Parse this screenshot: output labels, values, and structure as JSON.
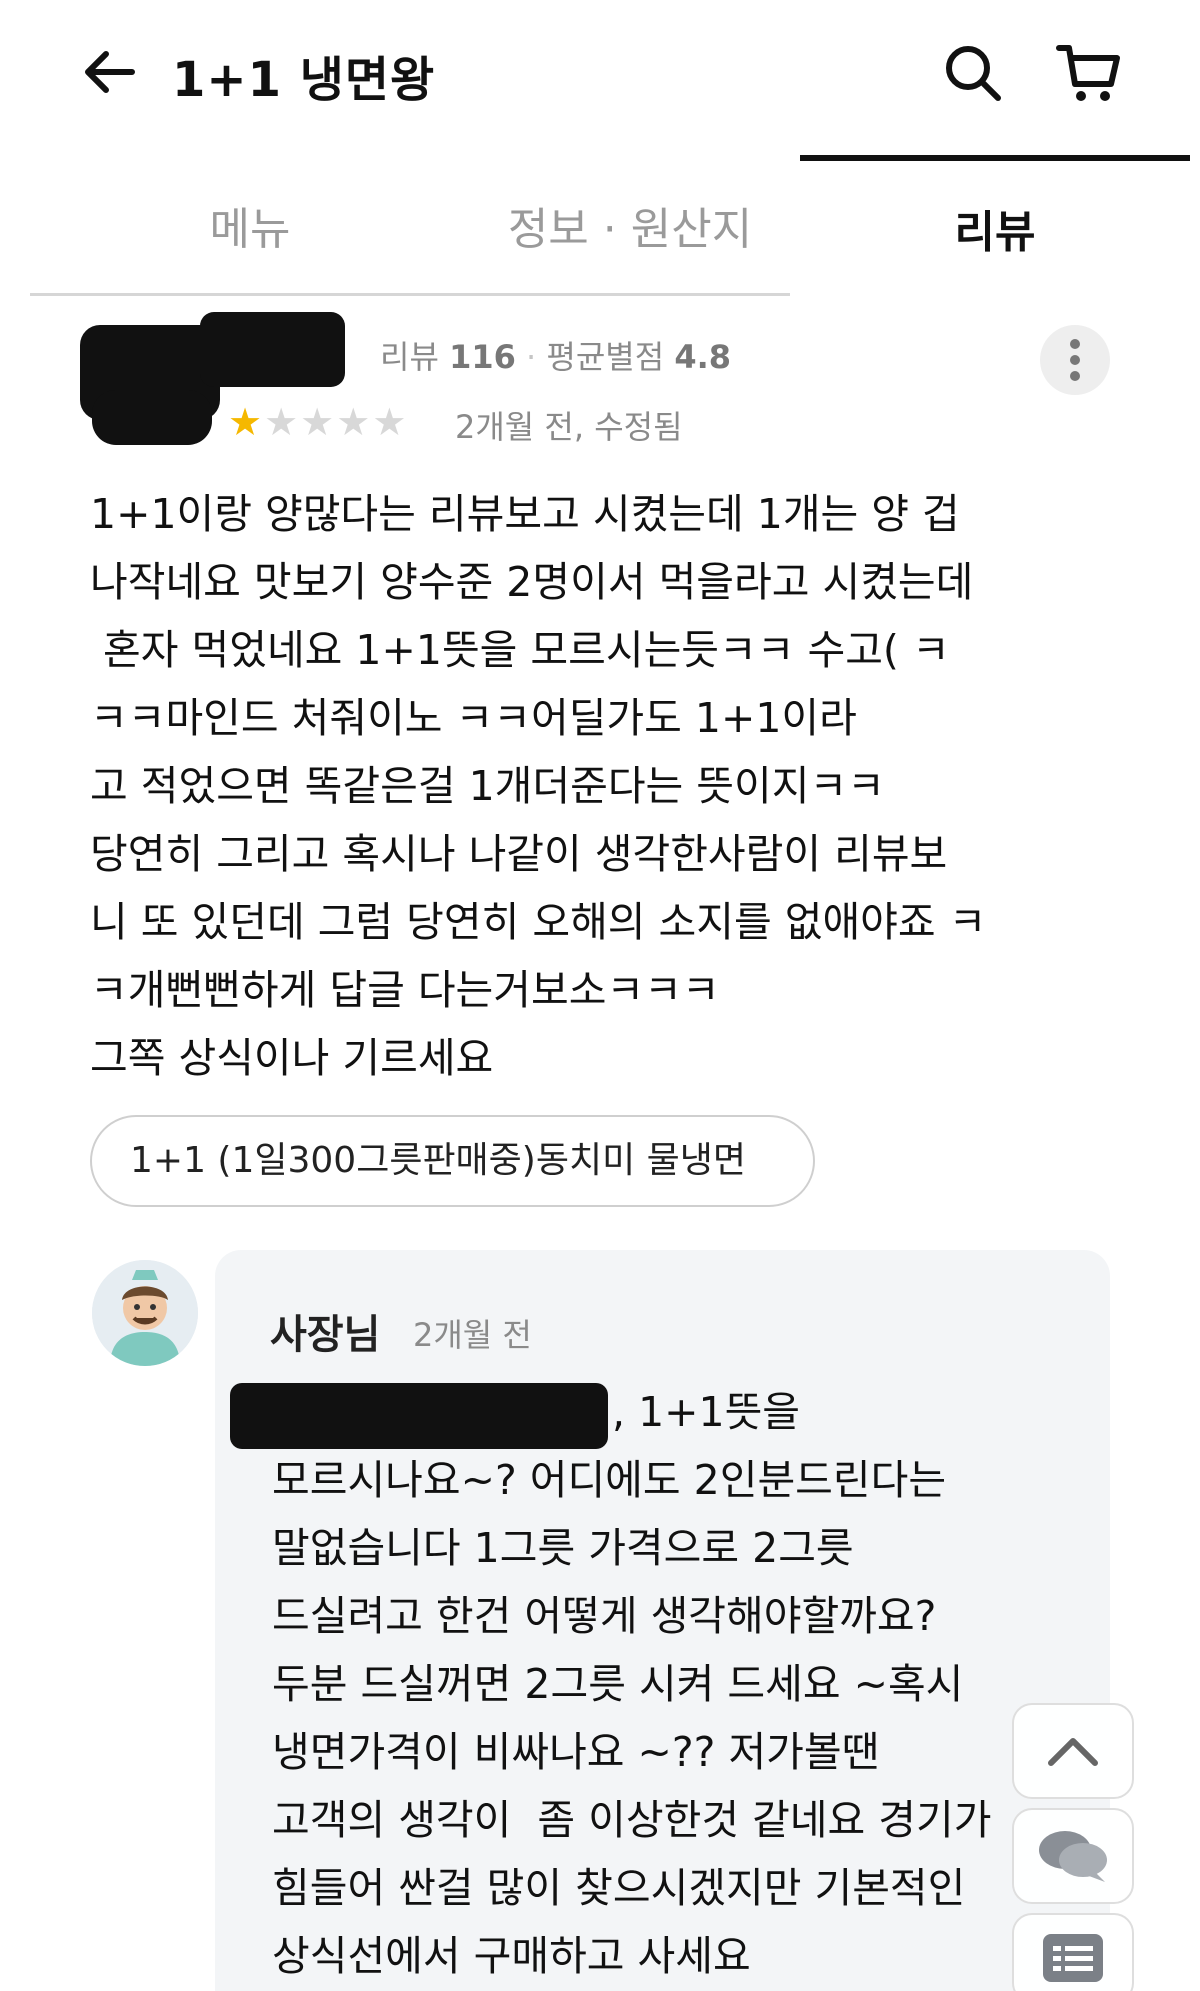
{
  "header": {
    "title": "1+1 냉면왕",
    "back_icon": "arrow-left-icon",
    "search_icon": "search-icon",
    "cart_icon": "cart-icon"
  },
  "tabs": [
    {
      "label": "메뉴",
      "active": false
    },
    {
      "label": "정보 · 원산지",
      "active": false
    },
    {
      "label": "리뷰",
      "active": true
    }
  ],
  "review": {
    "reviewer_stats": {
      "review_label": "리뷰",
      "review_count": "116",
      "separator": "·",
      "avg_label": "평균별점",
      "avg_rating": "4.8"
    },
    "rating": 1,
    "rating_max": 5,
    "date": "2개월 전, 수정됨",
    "body_lines": [
      "1+1이랑 양많다는 리뷰보고 시켰는데 1개는 양 겁",
      "나작네요 맛보기 양수준 2명이서 먹을라고 시켰는데",
      " 혼자 먹었네요 1+1뜻을 모르시는듯ㅋㅋ 수고( ㅋ",
      "ㅋㅋ마인드 처줘이노 ㅋㅋ어딜가도 1+1이라",
      "고 적었으면 똑같은걸 1개더준다는 뜻이지ㅋㅋ",
      "당연히 그리고 혹시나 나같이 생각한사람이 리뷰보",
      "니 또 있던데 그럼 당연히 오해의 소지를 없애야죠 ㅋ",
      "ㅋ개뻔뻔하게 답글 다는거보소ㅋㅋㅋ",
      "그쪽 상식이나 기르세요"
    ],
    "menu_tag": "1+1 (1일300그릇판매중)동치미 물냉면"
  },
  "reply": {
    "author": "사장님",
    "date": "2개월 전",
    "first_line_suffix": ", 1+1뜻을",
    "body_lines": [
      "모르시나요~? 어디에도 2인분드린다는",
      "말없습니다 1그릇 가격으로 2그릇",
      "드실려고 한건 어떻게 생각해야할까요?",
      "두분 드실꺼면 2그릇 시켜 드세요 ~혹시",
      "냉면가격이 비싸나요 ~?? 저가볼땐",
      "고객의 생각이  좀 이상한것 같네요 경기가",
      "힘들어 싼걸 많이 찾으시겠지만 기본적인",
      "상식선에서 구매하고 사세요"
    ]
  },
  "floating_buttons": [
    "chevron-up-icon",
    "chat-icon",
    "list-icon"
  ],
  "colors": {
    "star_filled": "#f5b800",
    "star_empty": "#d8d8d8",
    "muted_text": "#8a8a8a",
    "reply_bg": "#f3f5f7"
  }
}
